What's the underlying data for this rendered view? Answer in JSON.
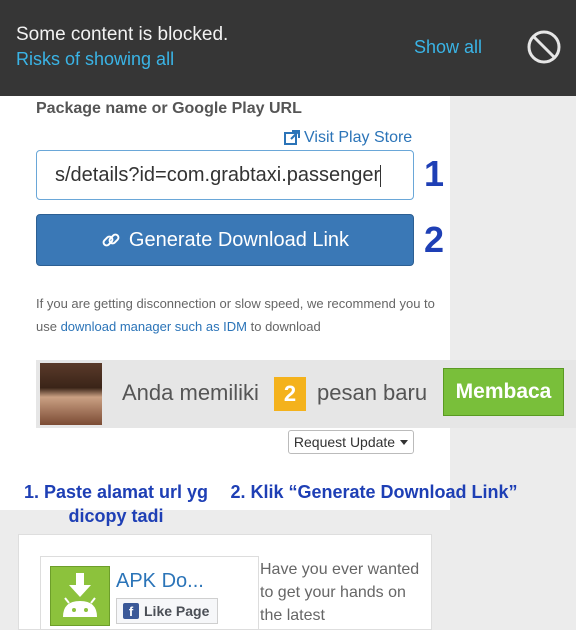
{
  "blocked_bar": {
    "title": "Some content is blocked.",
    "risks_link": "Risks of showing all",
    "show_all": "Show all"
  },
  "form": {
    "package_label": "Package name or Google Play URL",
    "visit_store": "Visit Play Store",
    "url_value": "s/details?id=com.grabtaxi.passenger",
    "generate_button": "Generate Download Link",
    "info_before": "If you are getting disconnection or slow speed, we recommend you to use ",
    "info_link": "download manager such as IDM",
    "info_after": " to download",
    "request_update": "Request Update"
  },
  "annotations": {
    "number_1": "1",
    "number_2": "2",
    "step_1": "1. Paste alamat url yg dicopy tadi",
    "step_2": "2. Klik “Generate Download Link”"
  },
  "ad": {
    "text_before": "Anda memiliki",
    "badge_count": "2",
    "text_after": "pesan baru",
    "button": "Membaca"
  },
  "sidebar_card": {
    "apk_title": "APK Do...",
    "like_button": "Like Page",
    "promo": "Have you ever wanted to get your hands on the latest"
  },
  "colors": {
    "accent_blue": "#3a78b6",
    "annotation_blue": "#1e3fb5",
    "link_blue": "#2b74b8",
    "ad_green": "#79bf3a",
    "badge_orange": "#f4b21c"
  }
}
